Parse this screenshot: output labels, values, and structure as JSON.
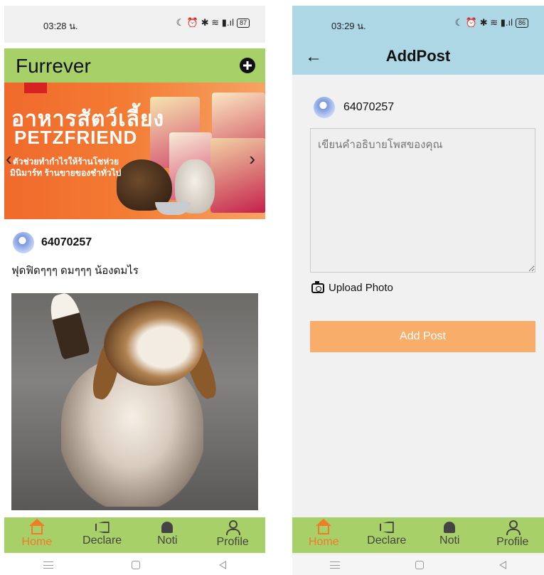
{
  "left": {
    "status": {
      "time": "03:28 น.",
      "icons": "☾ ⏰ ✱ ≋ ▮.ıl",
      "battery": "87"
    },
    "app_title": "Furrever",
    "banner": {
      "line1": "อาหารสัตว์เลี้ยง",
      "line2": "PETZFRIEND",
      "line3": "ตัวช่วยทำกำไรให้ร้านโชห่วย",
      "line4": "มินิมาร์ท ร้านขายของชำทั่วไป",
      "prev": "‹",
      "next": "›"
    },
    "post": {
      "username": "64070257",
      "caption": "ฟุดฟิดๆๆๆ ดมๆๆๆ น้องดมไร"
    }
  },
  "right": {
    "status": {
      "time": "03:29 น.",
      "icons": "☾ ⏰ ✱ ≋ ▮.ıl",
      "battery": "86"
    },
    "back": "←",
    "title": "AddPost",
    "username": "64070257",
    "description_placeholder": "เขียนคำอธิบายโพสของคุณ",
    "upload_label": "Upload Photo",
    "submit_label": "Add Post"
  },
  "nav": {
    "items": [
      {
        "label": "Home",
        "icon": "home-icon",
        "active": true
      },
      {
        "label": "Declare",
        "icon": "megaphone-icon",
        "active": false
      },
      {
        "label": "Noti",
        "icon": "bell-icon",
        "active": false
      },
      {
        "label": "Profile",
        "icon": "person-icon",
        "active": false
      }
    ]
  },
  "colors": {
    "header_green": "#a7d068",
    "active_orange": "#f07c27",
    "button_orange": "#f8ad6b",
    "addpost_header_blue": "#aed7e6"
  }
}
